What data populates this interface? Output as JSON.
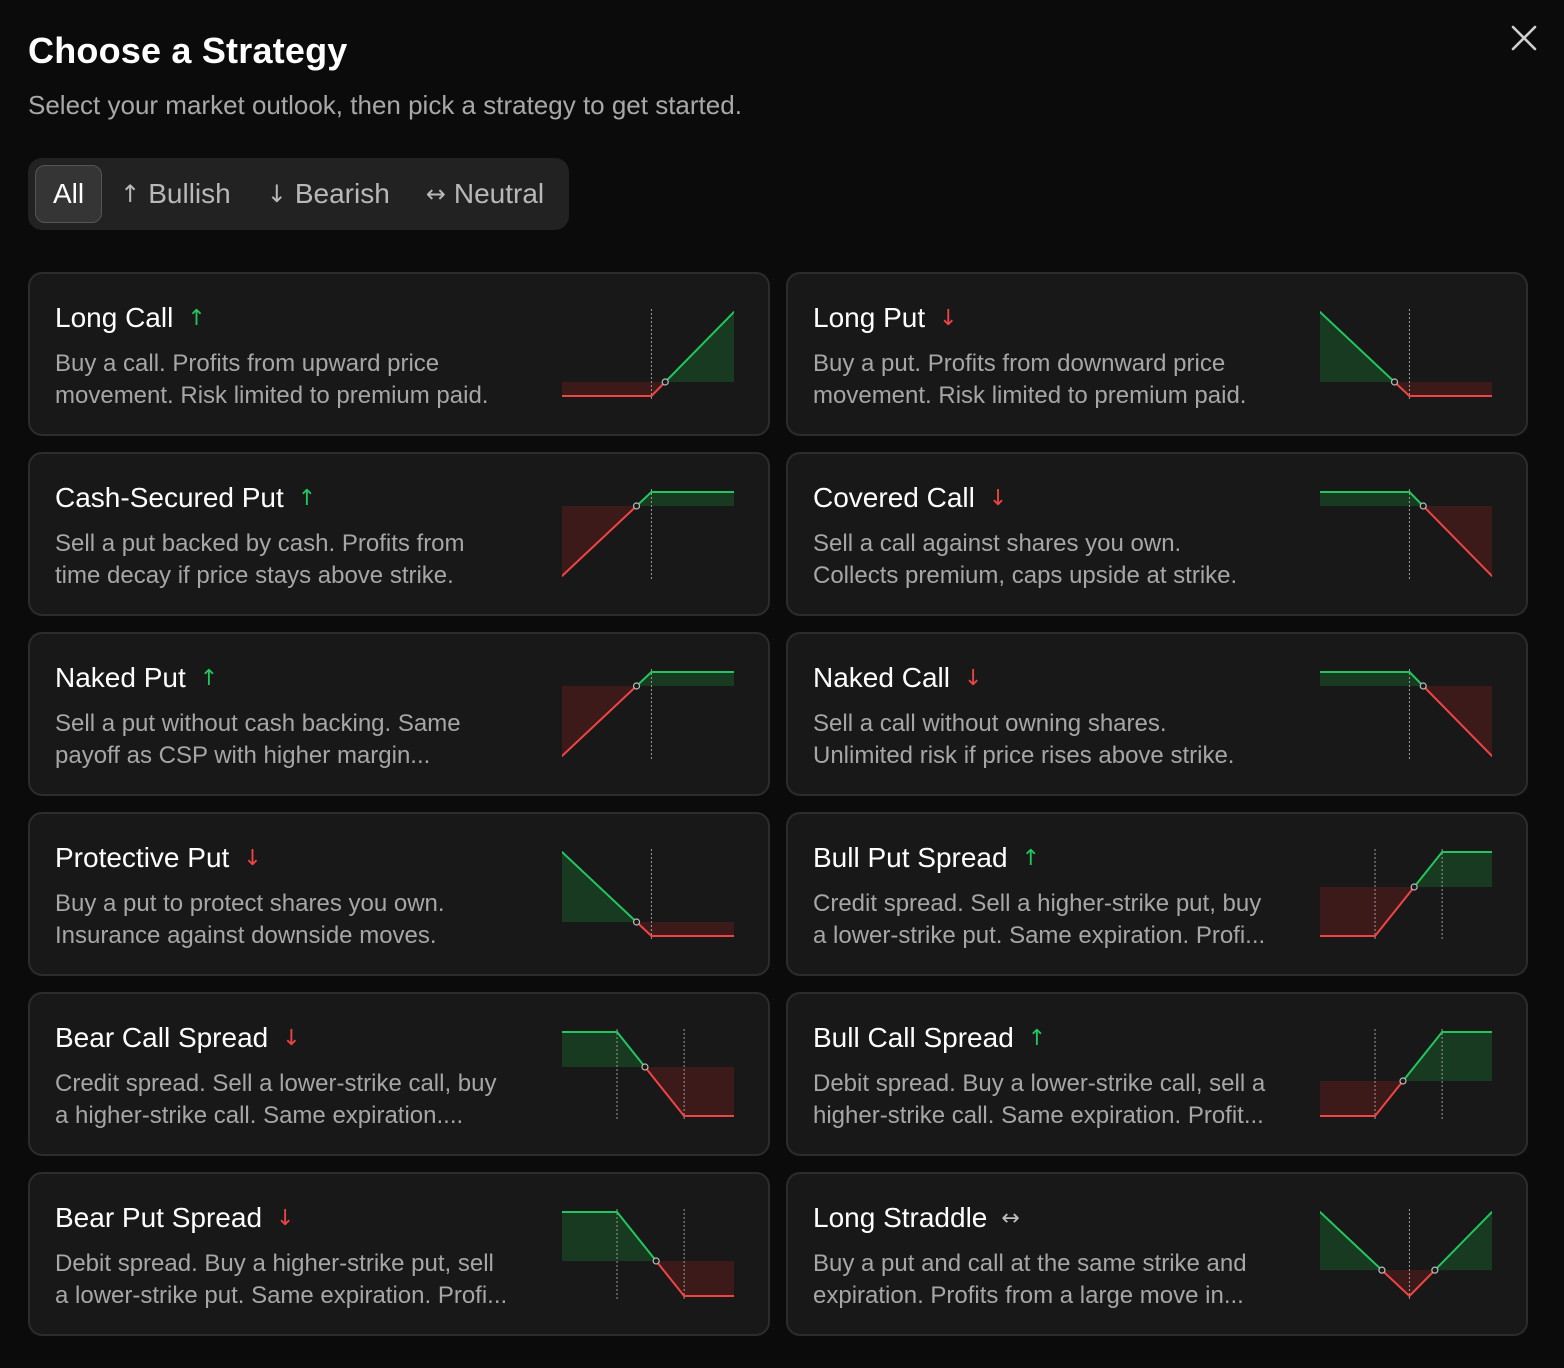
{
  "header": {
    "title": "Choose a Strategy",
    "subtitle": "Select your market outlook, then pick a strategy to get started."
  },
  "icons": {
    "close": "close-icon",
    "up": "arrow-up-icon",
    "down": "arrow-down-icon",
    "neutral": "arrow-left-right-icon"
  },
  "colors": {
    "bullish": "#22c55e",
    "bearish": "#ef4444",
    "profit_fill": "#173a21",
    "loss_fill": "#3d1a1a",
    "card_bg": "#181818",
    "card_border": "#2c2c2c"
  },
  "filters": [
    {
      "label": "All",
      "glyph": "",
      "active": true
    },
    {
      "label": "Bullish",
      "glyph": "↑",
      "active": false
    },
    {
      "label": "Bearish",
      "glyph": "↓",
      "active": false
    },
    {
      "label": "Neutral",
      "glyph": "↔",
      "active": false
    }
  ],
  "strategies": [
    {
      "title": "Long Call",
      "direction": "up",
      "direction_glyph": "↑",
      "desc_lines": [
        "Buy a call. Profits from upward price",
        "movement. Risk limited to premium paid."
      ],
      "payoff": {
        "pts": [
          [
            0,
            -1
          ],
          [
            0.52,
            -1
          ],
          [
            1,
            5
          ]
        ],
        "strikes": [
          0.52
        ]
      }
    },
    {
      "title": "Long Put",
      "direction": "down",
      "direction_glyph": "↓",
      "desc_lines": [
        "Buy a put. Profits from downward price",
        "movement. Risk limited to premium paid."
      ],
      "payoff": {
        "pts": [
          [
            0,
            5
          ],
          [
            0.52,
            -1
          ],
          [
            1,
            -1
          ]
        ],
        "strikes": [
          0.52
        ]
      }
    },
    {
      "title": "Cash-Secured Put",
      "direction": "up",
      "direction_glyph": "↑",
      "desc_lines": [
        "Sell a put backed by cash. Profits from",
        "time decay if price stays above strike."
      ],
      "payoff": {
        "pts": [
          [
            0,
            -5
          ],
          [
            0.52,
            1
          ],
          [
            1,
            1
          ]
        ],
        "strikes": [
          0.52
        ]
      }
    },
    {
      "title": "Covered Call",
      "direction": "down",
      "direction_glyph": "↓",
      "desc_lines": [
        "Sell a call against shares you own.",
        "Collects premium, caps upside at strike."
      ],
      "payoff": {
        "pts": [
          [
            0,
            1
          ],
          [
            0.52,
            1
          ],
          [
            1,
            -5
          ]
        ],
        "strikes": [
          0.52
        ]
      }
    },
    {
      "title": "Naked Put",
      "direction": "up",
      "direction_glyph": "↑",
      "desc_lines": [
        "Sell a put without cash backing. Same",
        "payoff as CSP with higher margin..."
      ],
      "payoff": {
        "pts": [
          [
            0,
            -5
          ],
          [
            0.52,
            1
          ],
          [
            1,
            1
          ]
        ],
        "strikes": [
          0.52
        ]
      }
    },
    {
      "title": "Naked Call",
      "direction": "down",
      "direction_glyph": "↓",
      "desc_lines": [
        "Sell a call without owning shares.",
        "Unlimited risk if price rises above strike."
      ],
      "payoff": {
        "pts": [
          [
            0,
            1
          ],
          [
            0.52,
            1
          ],
          [
            1,
            -5
          ]
        ],
        "strikes": [
          0.52
        ]
      }
    },
    {
      "title": "Protective Put",
      "direction": "down",
      "direction_glyph": "↓",
      "desc_lines": [
        "Buy a put to protect shares you own.",
        "Insurance against downside moves."
      ],
      "payoff": {
        "pts": [
          [
            0,
            5
          ],
          [
            0.52,
            -1
          ],
          [
            1,
            -1
          ]
        ],
        "strikes": [
          0.52
        ]
      }
    },
    {
      "title": "Bull Put Spread",
      "direction": "up",
      "direction_glyph": "↑",
      "desc_lines": [
        "Credit spread. Sell a higher-strike put, buy",
        "a lower-strike put. Same expiration. Profi..."
      ],
      "payoff": {
        "pts": [
          [
            0,
            -3.5
          ],
          [
            0.32,
            -3.5
          ],
          [
            0.71,
            2.5
          ],
          [
            1,
            2.5
          ]
        ],
        "strikes": [
          0.32,
          0.71
        ]
      }
    },
    {
      "title": "Bear Call Spread",
      "direction": "down",
      "direction_glyph": "↓",
      "desc_lines": [
        "Credit spread. Sell a lower-strike call, buy",
        "a higher-strike call. Same expiration...."
      ],
      "payoff": {
        "pts": [
          [
            0,
            2.5
          ],
          [
            0.32,
            2.5
          ],
          [
            0.71,
            -3.5
          ],
          [
            1,
            -3.5
          ]
        ],
        "strikes": [
          0.32,
          0.71
        ]
      }
    },
    {
      "title": "Bull Call Spread",
      "direction": "up",
      "direction_glyph": "↑",
      "desc_lines": [
        "Debit spread. Buy a lower-strike call, sell a",
        "higher-strike call. Same expiration. Profit..."
      ],
      "payoff": {
        "pts": [
          [
            0,
            -2.5
          ],
          [
            0.32,
            -2.5
          ],
          [
            0.71,
            3.5
          ],
          [
            1,
            3.5
          ]
        ],
        "strikes": [
          0.32,
          0.71
        ]
      }
    },
    {
      "title": "Bear Put Spread",
      "direction": "down",
      "direction_glyph": "↓",
      "desc_lines": [
        "Debit spread. Buy a higher-strike put, sell",
        "a lower-strike put. Same expiration. Profi..."
      ],
      "payoff": {
        "pts": [
          [
            0,
            3.5
          ],
          [
            0.32,
            3.5
          ],
          [
            0.71,
            -2.5
          ],
          [
            1,
            -2.5
          ]
        ],
        "strikes": [
          0.32,
          0.71
        ]
      }
    },
    {
      "title": "Long Straddle",
      "direction": "neutral",
      "direction_glyph": "↔",
      "desc_lines": [
        "Buy a put and call at the same strike and",
        "expiration. Profits from a large move in..."
      ],
      "payoff": {
        "pts": [
          [
            0,
            4.5
          ],
          [
            0.52,
            -2
          ],
          [
            1,
            4.5
          ]
        ],
        "strikes": [
          0.52
        ]
      }
    }
  ]
}
